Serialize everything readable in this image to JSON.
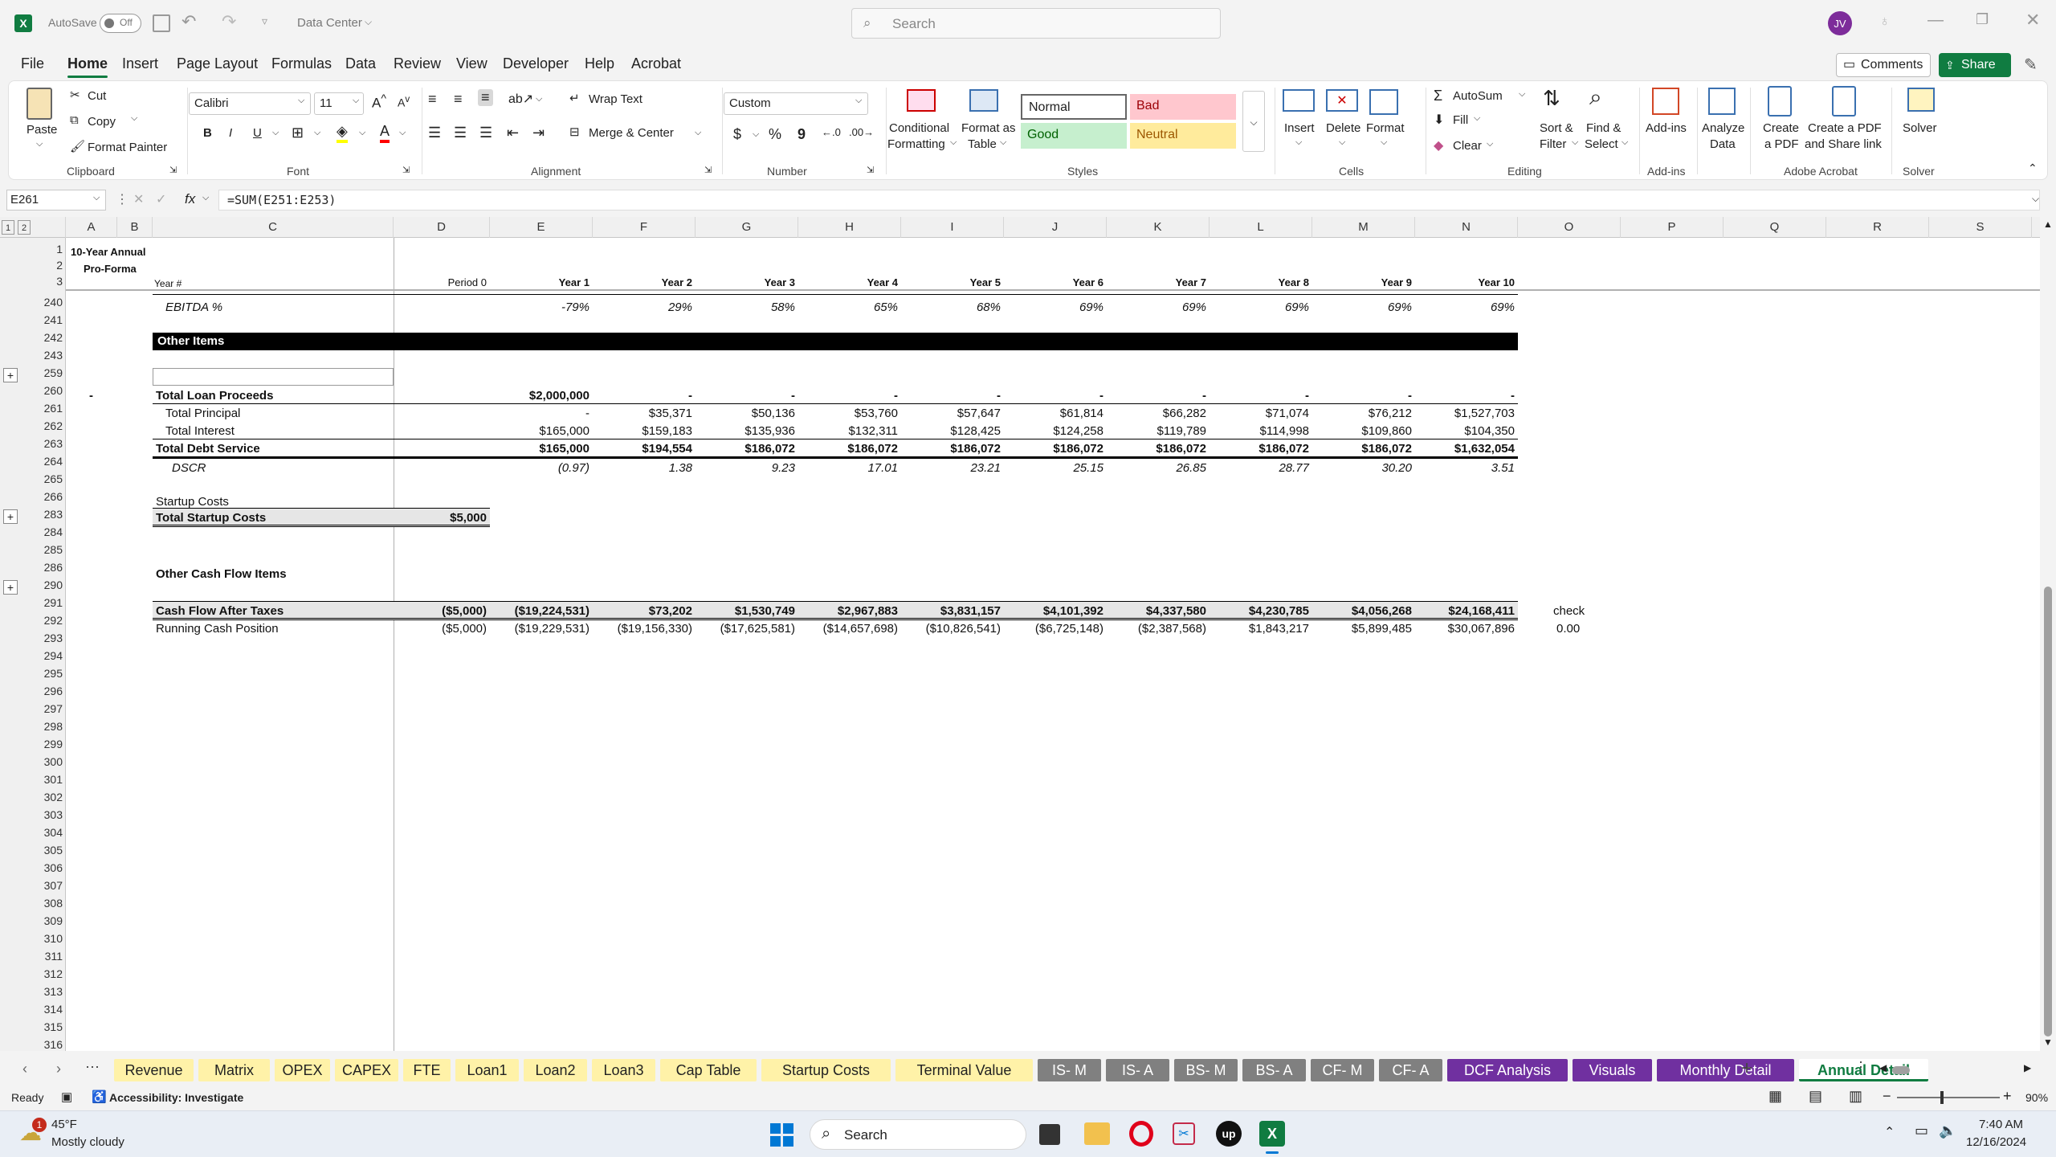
{
  "titlebar": {
    "autosave_label": "AutoSave",
    "autosave_state": "Off",
    "doc_title": "Data Center",
    "search_placeholder": "Search",
    "avatar_initials": "JV"
  },
  "menu": [
    "File",
    "Home",
    "Insert",
    "Page Layout",
    "Formulas",
    "Data",
    "Review",
    "View",
    "Developer",
    "Help",
    "Acrobat"
  ],
  "menu_active": "Home",
  "menu_right": {
    "comments": "Comments",
    "share": "Share"
  },
  "ribbon": {
    "clipboard": {
      "paste": "Paste",
      "cut": "Cut",
      "copy": "Copy",
      "format_painter": "Format Painter",
      "group": "Clipboard"
    },
    "font": {
      "name": "Calibri",
      "size": "11",
      "bold": "B",
      "italic": "I",
      "underline": "U",
      "group": "Font"
    },
    "alignment": {
      "wrap": "Wrap Text",
      "merge": "Merge & Center",
      "group": "Alignment"
    },
    "number": {
      "format": "Custom",
      "currency": "$",
      "percent": "%",
      "comma": "9",
      "group": "Number"
    },
    "styles": {
      "conditional": "Conditional",
      "conditional2": "Formatting",
      "format_table": "Format as",
      "format_table2": "Table",
      "normal": "Normal",
      "bad": "Bad",
      "good": "Good",
      "neutral": "Neutral",
      "group": "Styles"
    },
    "cells": {
      "insert": "Insert",
      "delete": "Delete",
      "format": "Format",
      "group": "Cells"
    },
    "editing": {
      "autosum": "AutoSum",
      "fill": "Fill",
      "clear": "Clear",
      "sort": "Sort &",
      "sort2": "Filter",
      "find": "Find &",
      "find2": "Select",
      "group": "Editing"
    },
    "addins": {
      "label": "Add-ins",
      "group": "Add-ins"
    },
    "analyze": {
      "label": "Analyze",
      "label2": "Data"
    },
    "acrobat": {
      "create": "Create",
      "create2": "a PDF",
      "share": "Create a PDF",
      "share2": "and Share link",
      "group": "Adobe Acrobat"
    },
    "solver": {
      "label": "Solver",
      "group": "Solver"
    }
  },
  "formula_bar": {
    "name_box": "E261",
    "formula": "=SUM(E251:E253)",
    "fx": "fx"
  },
  "columns": [
    "A",
    "B",
    "C",
    "D",
    "E",
    "F",
    "G",
    "H",
    "I",
    "J",
    "K",
    "L",
    "M",
    "N",
    "O",
    "P",
    "Q",
    "R",
    "S"
  ],
  "outline_levels": [
    "1",
    "2"
  ],
  "frozen": {
    "title1": "10-Year Annual",
    "title2": "Pro-Forma",
    "year_label": "Year #",
    "years": [
      "Period 0",
      "Year 1",
      "Year 2",
      "Year 3",
      "Year 4",
      "Year 5",
      "Year 6",
      "Year 7",
      "Year 8",
      "Year 9",
      "Year 10"
    ]
  },
  "rows": {
    "numbers_frozen": [
      "1",
      "2",
      "3"
    ],
    "numbers": [
      "240",
      "241",
      "242",
      "243",
      "259",
      "260",
      "261",
      "262",
      "263",
      "264",
      "265",
      "266",
      "283",
      "284",
      "285",
      "286",
      "290",
      "291",
      "292",
      "293",
      "294",
      "295",
      "296",
      "297",
      "298",
      "299",
      "300",
      "301",
      "302",
      "303",
      "304",
      "305",
      "306",
      "307",
      "308",
      "309",
      "310",
      "311",
      "312",
      "313",
      "314",
      "315",
      "316"
    ],
    "ebitda_pct": {
      "label": "EBITDA %",
      "values": [
        "-79%",
        "29%",
        "58%",
        "65%",
        "68%",
        "69%",
        "69%",
        "69%",
        "69%",
        "69%"
      ]
    },
    "other_items": "Other Items",
    "total_loan_proceeds": {
      "label": "Total Loan Proceeds",
      "values": [
        "$2,000,000",
        "-",
        "-",
        "-",
        "-",
        "-",
        "-",
        "-",
        "-",
        "-",
        "-"
      ]
    },
    "total_principal": {
      "label": "Total Principal",
      "values": [
        "-",
        "$35,371",
        "$50,136",
        "$53,760",
        "$57,647",
        "$61,814",
        "$66,282",
        "$71,074",
        "$76,212",
        "$1,527,703"
      ]
    },
    "total_interest": {
      "label": "Total Interest",
      "values": [
        "$165,000",
        "$159,183",
        "$135,936",
        "$132,311",
        "$128,425",
        "$124,258",
        "$119,789",
        "$114,998",
        "$109,860",
        "$104,350"
      ]
    },
    "total_debt_service": {
      "label": "Total Debt Service",
      "values": [
        "$165,000",
        "$194,554",
        "$186,072",
        "$186,072",
        "$186,072",
        "$186,072",
        "$186,072",
        "$186,072",
        "$186,072",
        "$1,632,054"
      ]
    },
    "dscr": {
      "label": "DSCR",
      "values": [
        "(0.97)",
        "1.38",
        "9.23",
        "17.01",
        "23.21",
        "25.15",
        "26.85",
        "28.77",
        "30.20",
        "3.51"
      ]
    },
    "startup_costs": "Startup Costs",
    "total_startup_costs": {
      "label": "Total Startup Costs",
      "value": "$5,000"
    },
    "other_cash_flow": "Other Cash Flow Items",
    "cash_flow_after_taxes": {
      "label": "Cash Flow After Taxes",
      "values": [
        "($5,000)",
        "($19,224,531)",
        "$73,202",
        "$1,530,749",
        "$2,967,883",
        "$3,831,157",
        "$4,101,392",
        "$4,337,580",
        "$4,230,785",
        "$4,056,268",
        "$24,168,411"
      ],
      "check_label": "check"
    },
    "running_cash_position": {
      "label": "Running Cash Position",
      "values": [
        "($5,000)",
        "($19,229,531)",
        "($19,156,330)",
        "($17,625,581)",
        "($14,657,698)",
        "($10,826,541)",
        "($6,725,148)",
        "($2,387,568)",
        "$1,843,217",
        "$5,899,485",
        "$30,067,896"
      ],
      "check_value": "0.00"
    }
  },
  "sheet_tabs": [
    {
      "label": "Revenue",
      "color": "#fff2a8"
    },
    {
      "label": "Matrix",
      "color": "#fff2a8"
    },
    {
      "label": "OPEX",
      "color": "#fff2a8"
    },
    {
      "label": "CAPEX",
      "color": "#fff2a8"
    },
    {
      "label": "FTE",
      "color": "#fff2a8"
    },
    {
      "label": "Loan1",
      "color": "#fff2a8"
    },
    {
      "label": "Loan2",
      "color": "#fff2a8"
    },
    {
      "label": "Loan3",
      "color": "#fff2a8"
    },
    {
      "label": "Cap Table",
      "color": "#fff2a8"
    },
    {
      "label": "Startup Costs",
      "color": "#fff2a8"
    },
    {
      "label": "Terminal Value",
      "color": "#fff2a8"
    },
    {
      "label": "IS- M",
      "color": "#808080"
    },
    {
      "label": "IS- A",
      "color": "#808080"
    },
    {
      "label": "BS- M",
      "color": "#808080"
    },
    {
      "label": "BS- A",
      "color": "#808080"
    },
    {
      "label": "CF- M",
      "color": "#808080"
    },
    {
      "label": "CF- A",
      "color": "#808080"
    },
    {
      "label": "DCF Analysis",
      "color": "#7030a0"
    },
    {
      "label": "Visuals",
      "color": "#7030a0"
    },
    {
      "label": "Monthly Detail",
      "color": "#7030a0"
    },
    {
      "label": "Annual Detail",
      "color": "#ffffff"
    }
  ],
  "status": {
    "ready": "Ready",
    "accessibility": "Accessibility: Investigate",
    "zoom": "90%"
  },
  "taskbar": {
    "weather_temp": "45°F",
    "weather_desc": "Mostly cloudy",
    "weather_badge": "1",
    "search": "Search",
    "time": "7:40 AM",
    "date": "12/16/2024"
  },
  "colors": {
    "excel_green": "#107c41",
    "black_band": "#000000",
    "purple_tab": "#7030a0",
    "grey_tab": "#808080",
    "yellow_tab": "#fff2a8"
  }
}
